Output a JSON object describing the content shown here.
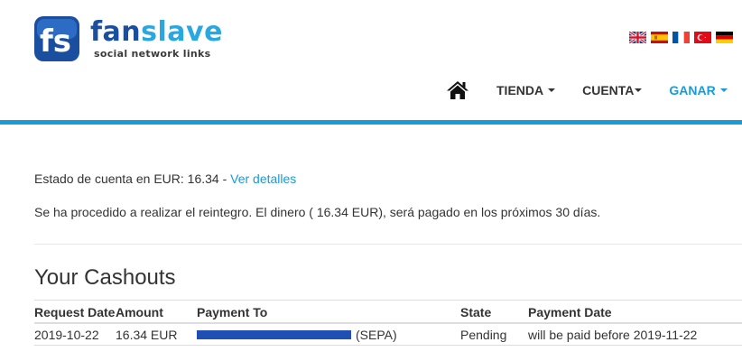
{
  "brand": {
    "name_part1": "fan",
    "name_part2": "slave",
    "tagline": "social network links",
    "primary_color": "#1a4fa0",
    "accent_color": "#1a9ad6"
  },
  "languages": [
    {
      "code": "en",
      "icon": "uk-flag-icon"
    },
    {
      "code": "es",
      "icon": "spain-flag-icon"
    },
    {
      "code": "fr",
      "icon": "france-flag-icon"
    },
    {
      "code": "tr",
      "icon": "turkey-flag-icon"
    },
    {
      "code": "de",
      "icon": "germany-flag-icon"
    }
  ],
  "nav": {
    "home_icon": "home-icon",
    "items": [
      {
        "label": "TIENDA"
      },
      {
        "label": "CUENTA"
      },
      {
        "label": "GANAR"
      }
    ]
  },
  "account": {
    "balance_prefix": "Estado de cuenta en EUR: 16.34 - ",
    "details_link": "Ver detalles",
    "message": "Se ha procedido a realizar el reintegro. El dinero ( 16.34 EUR), será pagado en los próximos 30 días."
  },
  "cashouts": {
    "title": "Your Cashouts",
    "columns": [
      "Request Date",
      "Amount",
      "Payment To",
      "State",
      "Payment Date"
    ],
    "rows": [
      {
        "request_date": "2019-10-22",
        "amount": "16.34 EUR",
        "payment_to_suffix": "(SEPA)",
        "state": "Pending",
        "payment_date": "will be paid before 2019-11-22"
      }
    ]
  }
}
